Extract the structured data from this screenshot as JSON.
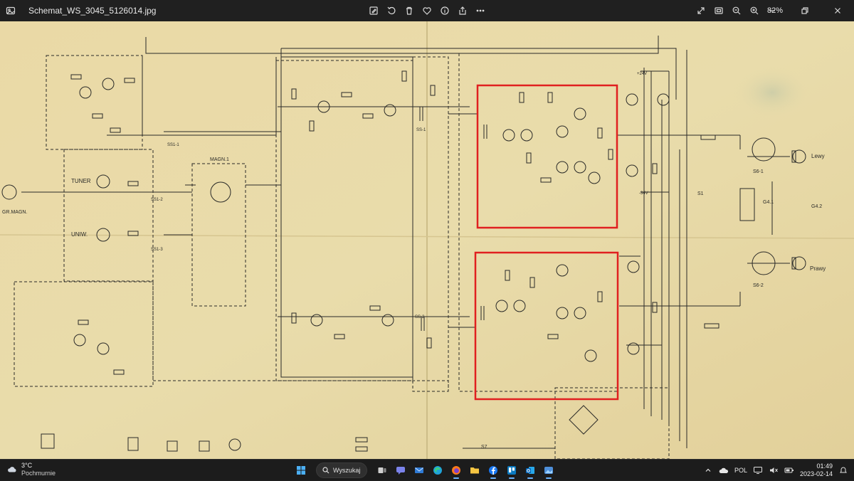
{
  "window": {
    "filename": "Schemat_WS_3045_5126014.jpg",
    "zoom": "82%"
  },
  "toolbar": {
    "icons": [
      "edit-image-icon",
      "rotate-icon",
      "delete-icon",
      "favorite-icon",
      "info-icon",
      "share-icon",
      "more-icon"
    ],
    "right_icons": [
      "fullscreen-icon",
      "fit-window-icon",
      "zoom-out-icon",
      "zoom-in-icon"
    ]
  },
  "schematic": {
    "labels": {
      "tuner": "TUNER",
      "uniw": "UNIW.",
      "gr_magn": "GR.MAGN.",
      "magn": "MAGN.1",
      "lewy": "Lewy",
      "prawy": "Prawy",
      "s61": "S6-1",
      "s62": "S6-2",
      "g41": "G4.1",
      "g42": "G4.2",
      "ss12": "SS1-2",
      "ss13": "SS1-3",
      "ss11": "SS1-1",
      "ss51": "SS-1",
      "ss52": "SS-2",
      "s1": "S1",
      "s7": "S7",
      "plus24": "+24V",
      "minus24": "-34V"
    },
    "highlight_color": "#e02020",
    "paper_color": "#e8dba8",
    "ink_color": "#2a2a28"
  },
  "taskbar": {
    "weather": {
      "temp": "3°C",
      "condition": "Pochmurnie"
    },
    "search_label": "Wyszukaj",
    "apps": [
      "start-icon",
      "task-view-icon",
      "chat-icon",
      "mail-icon",
      "edge-icon",
      "firefox-icon",
      "folder-icon",
      "facebook-icon",
      "trello-icon",
      "outlook-icon",
      "photos-icon"
    ],
    "language": "POL",
    "time": "01:49",
    "date": "2023-02-14"
  }
}
